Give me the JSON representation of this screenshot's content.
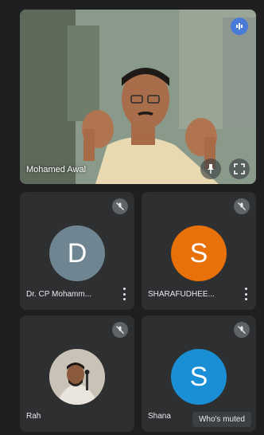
{
  "main": {
    "speaker_name": "Mohamed Awal"
  },
  "participants": [
    {
      "initial": "D",
      "name": "Dr. CP Mohamm...",
      "muted": true
    },
    {
      "initial": "S",
      "name": "SHARAFUDHEE...",
      "muted": true
    },
    {
      "initial": "",
      "name": "Rah",
      "muted": true
    },
    {
      "initial": "S",
      "name": "Shana",
      "muted": true
    }
  ],
  "tooltip": "Who's muted",
  "colors": {
    "avatar_d": "#6f8591",
    "avatar_s1": "#e8710a",
    "avatar_s2": "#1a8fd6",
    "speaking_indicator": "#4b7bd8"
  },
  "icons": [
    "mic-speaking-icon",
    "pin-icon",
    "fullscreen-icon",
    "mic-off-icon",
    "more-vert-icon"
  ]
}
